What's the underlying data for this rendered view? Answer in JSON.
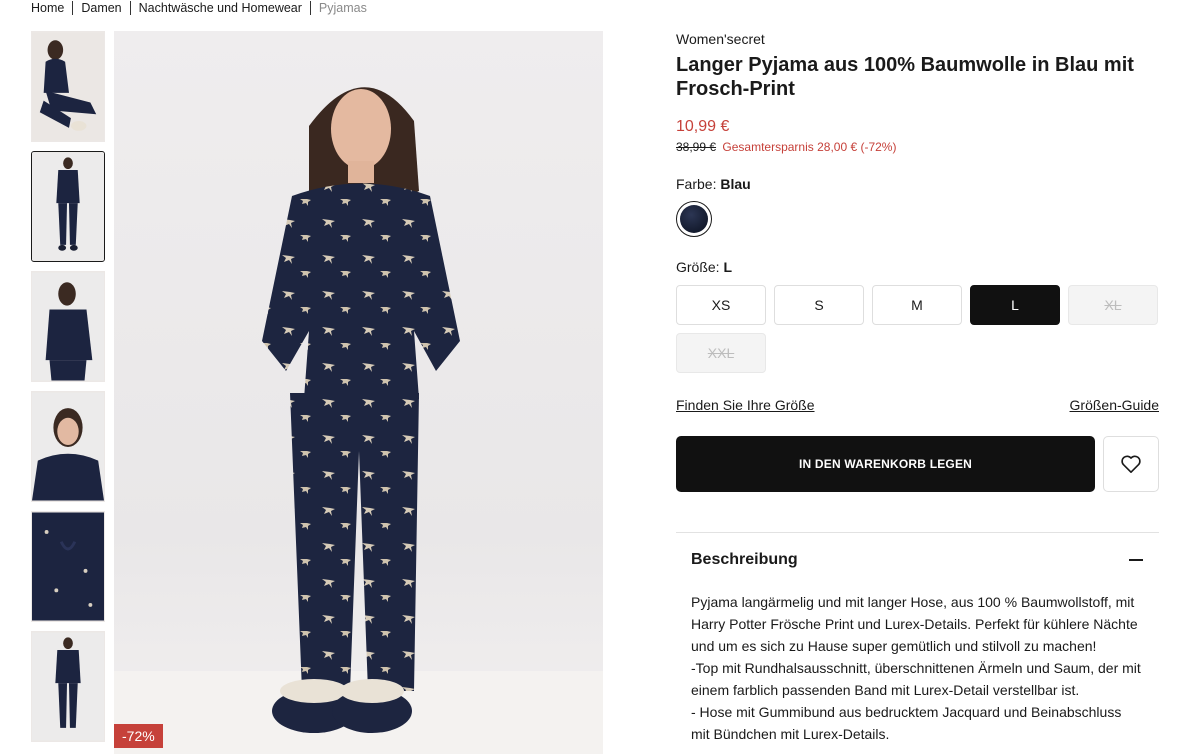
{
  "breadcrumb": [
    "Home",
    "Damen",
    "Nachtwäsche und Homewear",
    "Pyjamas"
  ],
  "product": {
    "brand": "Women'secret",
    "title": "Langer Pyjama aus 100% Baumwolle in Blau mit Frosch-Print",
    "price": "10,99 €",
    "old_price": "38,99 €",
    "savings": "Gesamtersparnis 28,00 € (-72%)",
    "discount_badge": "-72%"
  },
  "color": {
    "label": "Farbe:",
    "value": "Blau",
    "swatch_color": "#1a2238"
  },
  "size": {
    "label": "Größe:",
    "value": "L",
    "options": [
      {
        "label": "XS",
        "state": "available"
      },
      {
        "label": "S",
        "state": "available"
      },
      {
        "label": "M",
        "state": "available"
      },
      {
        "label": "L",
        "state": "selected"
      },
      {
        "label": "XL",
        "state": "disabled"
      },
      {
        "label": "XXL",
        "state": "disabled"
      }
    ]
  },
  "links": {
    "find_size": "Finden Sie Ihre Größe",
    "size_guide": "Größen-Guide"
  },
  "cart": {
    "add_label": "IN DEN WARENKORB LEGEN"
  },
  "description": {
    "title": "Beschreibung",
    "paragraphs": [
      "Pyjama langärmelig und mit langer Hose, aus 100 % Baumwollstoff, mit Harry Potter Frösche Print und Lurex-Details. Perfekt für kühlere Nächte und um es sich zu Hause super gemütlich und stilvoll zu machen!",
      "-Top mit Rundhalsausschnitt, überschnittenen Ärmeln und Saum, der mit einem farblich passenden Band mit Lurex-Detail verstellbar ist.",
      "- Hose mit Gummibund aus bedrucktem Jacquard und Beinabschluss mit Bündchen mit Lurex-Details."
    ]
  },
  "colors": {
    "accent_red": "#c6413a",
    "button_black": "#111111"
  }
}
